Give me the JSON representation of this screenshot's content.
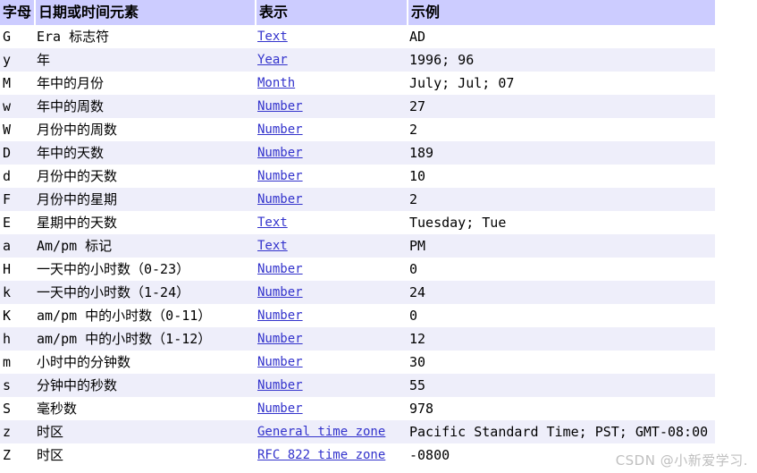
{
  "table": {
    "headers": [
      {
        "label": "字母",
        "name": "column-header-letter"
      },
      {
        "label": "日期或时间元素",
        "name": "column-header-element"
      },
      {
        "label": "表示",
        "name": "column-header-presentation"
      },
      {
        "label": "示例",
        "name": "column-header-example"
      }
    ],
    "rows": [
      {
        "letter": "G",
        "element": "Era 标志符",
        "presentation": "Text",
        "example": "AD"
      },
      {
        "letter": "y",
        "element": "年",
        "presentation": "Year",
        "example": "1996; 96"
      },
      {
        "letter": "M",
        "element": "年中的月份",
        "presentation": "Month",
        "example": "July; Jul; 07"
      },
      {
        "letter": "w",
        "element": "年中的周数",
        "presentation": "Number",
        "example": "27"
      },
      {
        "letter": "W",
        "element": "月份中的周数",
        "presentation": "Number",
        "example": "2"
      },
      {
        "letter": "D",
        "element": "年中的天数",
        "presentation": "Number",
        "example": "189"
      },
      {
        "letter": "d",
        "element": "月份中的天数",
        "presentation": "Number",
        "example": "10"
      },
      {
        "letter": "F",
        "element": "月份中的星期",
        "presentation": "Number",
        "example": "2"
      },
      {
        "letter": "E",
        "element": "星期中的天数",
        "presentation": "Text",
        "example": "Tuesday; Tue"
      },
      {
        "letter": "a",
        "element": "Am/pm 标记",
        "presentation": "Text",
        "example": "PM"
      },
      {
        "letter": "H",
        "element": "一天中的小时数（0-23）",
        "presentation": "Number",
        "example": "0"
      },
      {
        "letter": "k",
        "element": "一天中的小时数（1-24）",
        "presentation": "Number",
        "example": "24"
      },
      {
        "letter": "K",
        "element": "am/pm 中的小时数（0-11）",
        "presentation": "Number",
        "example": "0"
      },
      {
        "letter": "h",
        "element": "am/pm 中的小时数（1-12）",
        "presentation": "Number",
        "example": "12"
      },
      {
        "letter": "m",
        "element": "小时中的分钟数",
        "presentation": "Number",
        "example": "30"
      },
      {
        "letter": "s",
        "element": "分钟中的秒数",
        "presentation": "Number",
        "example": "55"
      },
      {
        "letter": "S",
        "element": "毫秒数",
        "presentation": "Number",
        "example": "978"
      },
      {
        "letter": "z",
        "element": "时区",
        "presentation": "General time zone",
        "example": "Pacific Standard Time; PST; GMT-08:00"
      },
      {
        "letter": "Z",
        "element": "时区",
        "presentation": "RFC 822 time zone",
        "example": "-0800"
      }
    ]
  },
  "watermark": {
    "text": "CSDN @小新爱学习."
  },
  "colors": {
    "header_bg": "#ccccff",
    "row_alt_bg": "#eeeefa",
    "row_bg": "#ffffff",
    "link": "#3333cc",
    "text": "#000000",
    "watermark": "#bfbfbf"
  }
}
